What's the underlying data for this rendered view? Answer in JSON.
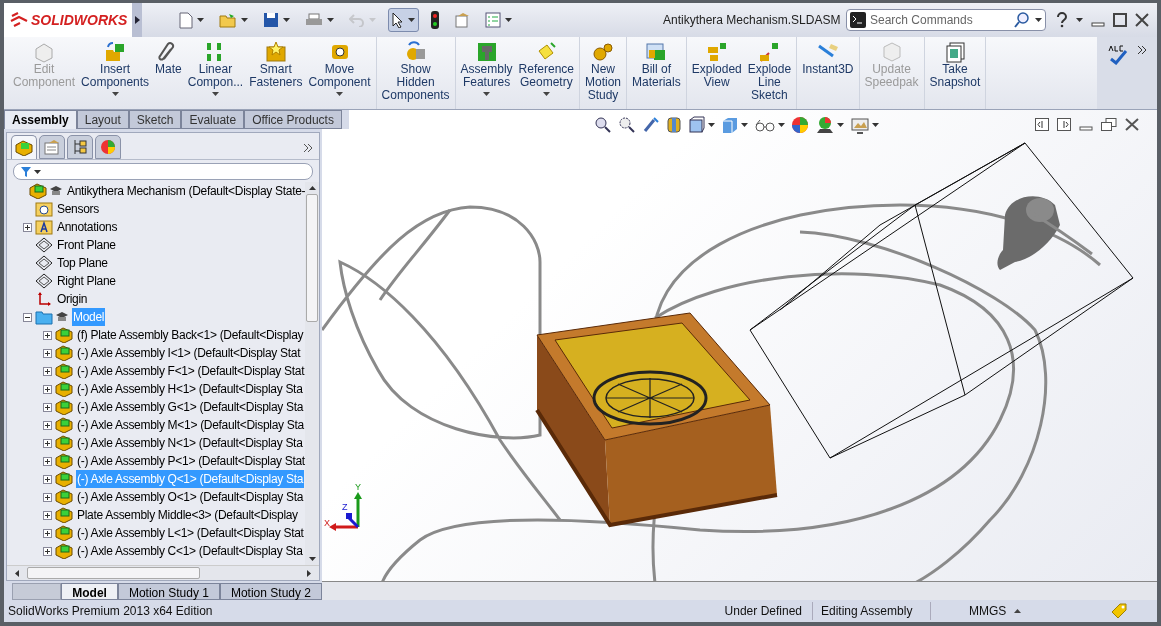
{
  "app": {
    "logo": "SOLIDWORKS"
  },
  "quick_access": [
    {
      "kind": "new",
      "disabled": false,
      "pressed": false
    },
    {
      "kind": "open",
      "disabled": false,
      "pressed": false
    },
    {
      "kind": "save",
      "disabled": false,
      "pressed": false
    },
    {
      "kind": "print",
      "disabled": false,
      "pressed": false
    },
    {
      "kind": "undo",
      "disabled": true,
      "pressed": false
    },
    {
      "kind": "select",
      "disabled": false,
      "pressed": true
    },
    {
      "kind": "rebuild",
      "disabled": false,
      "pressed": false
    },
    {
      "kind": "options",
      "disabled": false,
      "pressed": false
    },
    {
      "kind": "checklist",
      "disabled": false,
      "pressed": false
    }
  ],
  "window": {
    "title": "Antikythera Mechanism.SLDASM"
  },
  "search": {
    "placeholder": "Search Commands"
  },
  "ribbon": {
    "groups": [
      [
        {
          "lines": [
            "Edit",
            "Component"
          ],
          "kind": "edit",
          "disabled": true,
          "dropdown": false
        },
        {
          "lines": [
            "Insert",
            "Components"
          ],
          "kind": "insert",
          "disabled": false,
          "dropdown": true
        },
        {
          "lines": [
            "Mate"
          ],
          "kind": "mate",
          "disabled": false,
          "dropdown": false
        },
        {
          "lines": [
            "Linear",
            "Compon..."
          ],
          "kind": "pattern",
          "disabled": false,
          "dropdown": true
        },
        {
          "lines": [
            "Smart",
            "Fasteners"
          ],
          "kind": "fastener",
          "disabled": false,
          "dropdown": false
        },
        {
          "lines": [
            "Move",
            "Component"
          ],
          "kind": "move",
          "disabled": false,
          "dropdown": true
        }
      ],
      [
        {
          "lines": [
            "Show",
            "Hidden",
            "Components"
          ],
          "kind": "show",
          "disabled": false,
          "dropdown": false
        }
      ],
      [
        {
          "lines": [
            "Assembly",
            "Features"
          ],
          "kind": "features",
          "disabled": false,
          "dropdown": true
        },
        {
          "lines": [
            "Reference",
            "Geometry"
          ],
          "kind": "reference",
          "disabled": false,
          "dropdown": true
        }
      ],
      [
        {
          "lines": [
            "New",
            "Motion",
            "Study"
          ],
          "kind": "motion",
          "disabled": false,
          "dropdown": false
        }
      ],
      [
        {
          "lines": [
            "Bill of",
            "Materials"
          ],
          "kind": "bom",
          "disabled": false,
          "dropdown": false
        }
      ],
      [
        {
          "lines": [
            "Exploded",
            "View"
          ],
          "kind": "explode",
          "disabled": false,
          "dropdown": false
        },
        {
          "lines": [
            "Explode",
            "Line",
            "Sketch"
          ],
          "kind": "explode-line",
          "disabled": false,
          "dropdown": false
        }
      ],
      [
        {
          "lines": [
            "Instant3D"
          ],
          "kind": "instant3d",
          "disabled": false,
          "dropdown": false
        }
      ],
      [
        {
          "lines": [
            "Update",
            "Speedpak"
          ],
          "kind": "speedpak",
          "disabled": true,
          "dropdown": false
        }
      ],
      [
        {
          "lines": [
            "Take",
            "Snapshot"
          ],
          "kind": "snapshot",
          "disabled": false,
          "dropdown": false
        }
      ]
    ]
  },
  "command_tabs": [
    {
      "label": "Assembly",
      "selected": true
    },
    {
      "label": "Layout",
      "selected": false
    },
    {
      "label": "Sketch",
      "selected": false
    },
    {
      "label": "Evaluate",
      "selected": false
    },
    {
      "label": "Office Products",
      "selected": false
    }
  ],
  "panel_tabs": [
    {
      "kind": "feature-tree",
      "selected": true
    },
    {
      "kind": "properties",
      "selected": false
    },
    {
      "kind": "configurations",
      "selected": false
    },
    {
      "kind": "appearance",
      "selected": false
    }
  ],
  "tree": [
    {
      "kind": "assembly",
      "label": "Antikythera Mechanism  (Default<Display State-",
      "selected": false,
      "children": [
        {
          "kind": "sensors",
          "label": "Sensors",
          "selected": false
        },
        {
          "kind": "annotations",
          "label": "Annotations",
          "selected": false,
          "expanded": false
        },
        {
          "kind": "plane",
          "label": "Front Plane",
          "selected": false
        },
        {
          "kind": "plane",
          "label": "Top Plane",
          "selected": false
        },
        {
          "kind": "plane",
          "label": "Right Plane",
          "selected": false
        },
        {
          "kind": "origin",
          "label": "Origin",
          "selected": false
        },
        {
          "kind": "folder",
          "label": "Model",
          "selected": true,
          "expanded": true,
          "children": [
            {
              "kind": "component",
              "label": "(f) Plate Assembly Back<1>  (Default<Display",
              "selected": false,
              "expanded": false
            },
            {
              "kind": "component",
              "label": "(-) Axle Assembly I<1>  (Default<Display Stat",
              "selected": false,
              "expanded": false
            },
            {
              "kind": "component",
              "label": "(-) Axle Assembly F<1>  (Default<Display Stat",
              "selected": false,
              "expanded": false
            },
            {
              "kind": "component",
              "label": "(-) Axle Assembly H<1>  (Default<Display Sta",
              "selected": false,
              "expanded": false
            },
            {
              "kind": "component",
              "label": "(-) Axle Assembly G<1>  (Default<Display Sta",
              "selected": false,
              "expanded": false
            },
            {
              "kind": "component",
              "label": "(-) Axle Assembly M<1>  (Default<Display Sta",
              "selected": false,
              "expanded": false
            },
            {
              "kind": "component",
              "label": "(-) Axle Assembly N<1>  (Default<Display Sta",
              "selected": false,
              "expanded": false
            },
            {
              "kind": "component",
              "label": "(-) Axle Assembly P<1>  (Default<Display Stat",
              "selected": false,
              "expanded": false
            },
            {
              "kind": "component",
              "label": "(-) Axle Assembly Q<1>  (Default<Display Sta",
              "selected": true,
              "expanded": false
            },
            {
              "kind": "component",
              "label": "(-) Axle Assembly O<1>  (Default<Display Sta",
              "selected": false,
              "expanded": false
            },
            {
              "kind": "component",
              "label": "Plate Assembly Middle<3>  (Default<Display",
              "selected": false,
              "expanded": false
            },
            {
              "kind": "component",
              "label": "(-) Axle Assembly L<1>  (Default<Display Stat",
              "selected": false,
              "expanded": false
            },
            {
              "kind": "component",
              "label": "(-) Axle Assembly C<1>  (Default<Display Sta",
              "selected": false,
              "expanded": false
            }
          ]
        }
      ]
    }
  ],
  "bottom_tabs": [
    {
      "label": "Model",
      "selected": true
    },
    {
      "label": "Motion Study 1",
      "selected": false
    },
    {
      "label": "Motion Study 2",
      "selected": false
    }
  ],
  "triad": {
    "x": "X",
    "y": "Y",
    "z": "Z"
  },
  "status_bar": {
    "edition": "SolidWorks Premium 2013 x64 Edition",
    "definition": "Under Defined",
    "mode": "Editing Assembly",
    "units": "MMGS"
  }
}
